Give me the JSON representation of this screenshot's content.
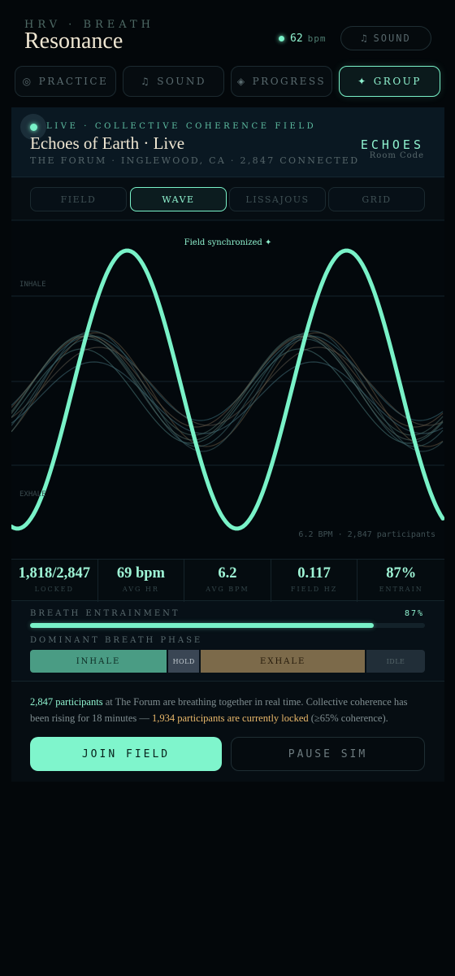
{
  "header": {
    "subtitle": "HRV · BREATH",
    "title": "Resonance",
    "bpm_value": "62",
    "bpm_unit": "bpm",
    "sound_label": "SOUND",
    "sound_icon": "music-note-icon"
  },
  "nav": [
    {
      "label": "PRACTICE",
      "icon": "◎",
      "icon_name": "target-icon",
      "active": false
    },
    {
      "label": "SOUND",
      "icon": "♫",
      "icon_name": "music-note-icon",
      "active": false
    },
    {
      "label": "PROGRESS",
      "icon": "◈",
      "icon_name": "diamond-icon",
      "active": false
    },
    {
      "label": "GROUP",
      "icon": "✦",
      "icon_name": "sparkle-icon",
      "active": true
    }
  ],
  "session": {
    "live_label": "LIVE · COLLECTIVE COHERENCE FIELD",
    "title": "Echoes of Earth · Live",
    "location": "THE FORUM · INGLEWOOD, CA · 2,847 CONNECTED",
    "room_code": "ECHOES",
    "room_code_label": "Room Code"
  },
  "view_tabs": [
    {
      "label": "FIELD",
      "active": false
    },
    {
      "label": "WAVE",
      "active": true
    },
    {
      "label": "LISSAJOUS",
      "active": false
    },
    {
      "label": "GRID",
      "active": false
    }
  ],
  "wave": {
    "sync_label": "Field synchronized ✦",
    "inhale_label": "INHALE",
    "exhale_label": "EXHALE",
    "footer": "6.2 BPM · 2,847 participants",
    "accent": "#79f2c8"
  },
  "stats": [
    {
      "value": "1,818/2,847",
      "label": "LOCKED"
    },
    {
      "value": "69 bpm",
      "label": "AVG HR"
    },
    {
      "value": "6.2",
      "label": "AVG BPM"
    },
    {
      "value": "0.117",
      "label": "FIELD HZ"
    },
    {
      "value": "87%",
      "label": "ENTRAIN"
    }
  ],
  "entrainment": {
    "label": "BREATH ENTRAINMENT",
    "percent_text": "87%",
    "fraction": 0.87
  },
  "phase": {
    "label": "DOMINANT BREATH PHASE",
    "segments": [
      {
        "label": "INHALE",
        "share": 0.35,
        "color": "#4a9c84",
        "text_color": "#0c2a22"
      },
      {
        "label": "HOLD",
        "share": 0.08,
        "color": "#3a4654",
        "text_color": "#c2cad0"
      },
      {
        "label": "EXHALE",
        "share": 0.42,
        "color": "#7c6a4a",
        "text_color": "#24190a"
      },
      {
        "label": "IDLE",
        "share": 0.15,
        "color": "#212e38",
        "text_color": "#56666a"
      }
    ]
  },
  "summary": {
    "part1": "2,847 participants",
    "part2": " at The Forum are breathing together in real time. Collective coherence has been rising for 18 minutes — ",
    "part3": "1,934 participants are currently locked",
    "part4": " (≥65% coherence)."
  },
  "actions": {
    "join_label": "JOIN FIELD",
    "pause_label": "PAUSE SIM"
  }
}
